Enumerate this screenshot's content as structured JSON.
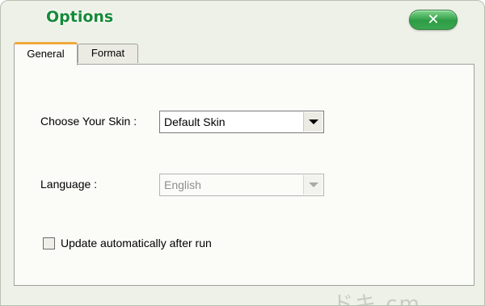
{
  "window": {
    "title": "Options",
    "close_icon_glyph": "✕"
  },
  "tabs": [
    {
      "label": "General",
      "active": true
    },
    {
      "label": "Format",
      "active": false
    }
  ],
  "general": {
    "skin": {
      "label": "Choose Your Skin :",
      "value": "Default Skin",
      "enabled": true
    },
    "language": {
      "label": "Language :",
      "value": "English",
      "enabled": false
    },
    "auto_update": {
      "label": "Update automatically after run",
      "checked": false
    }
  },
  "colors": {
    "title_green": "#168a3a",
    "close_button_green": "#2d9c45",
    "active_tab_accent": "#f0a93c"
  }
}
